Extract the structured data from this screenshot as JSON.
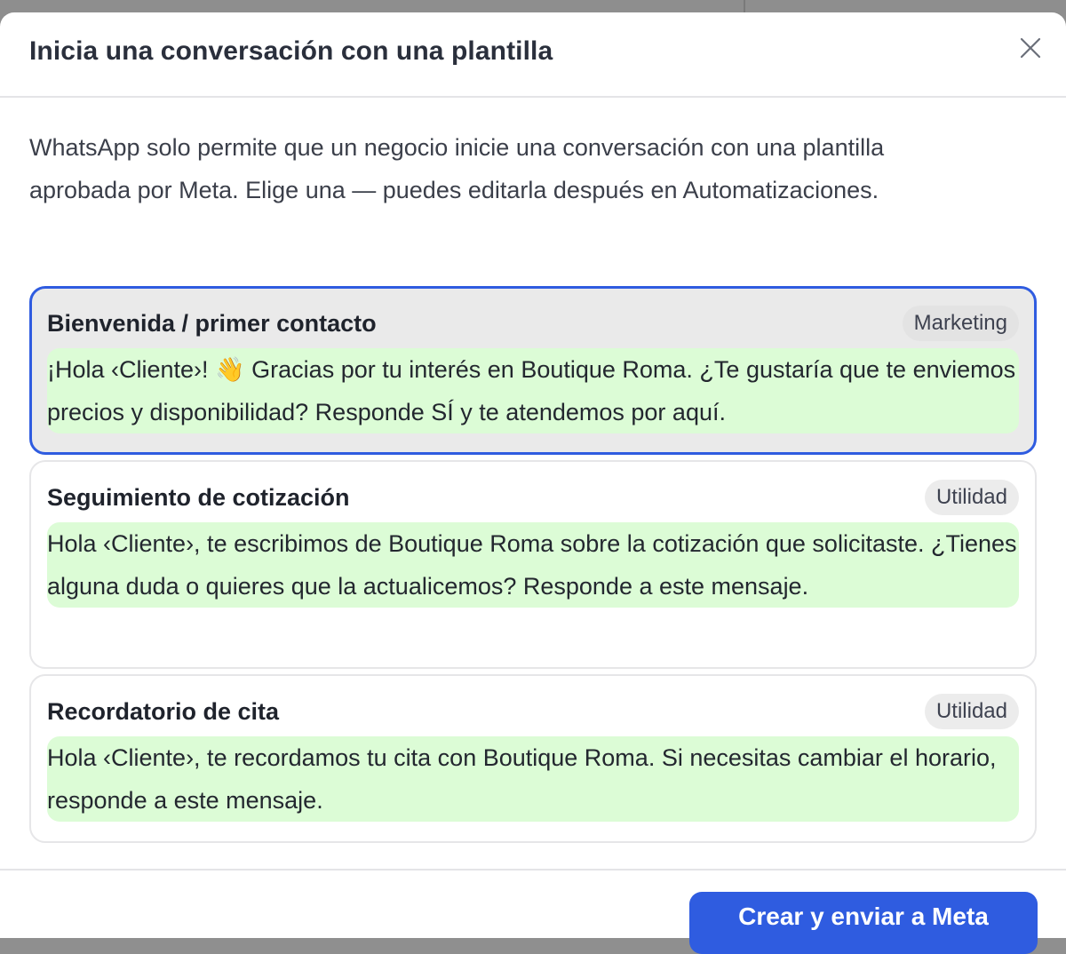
{
  "modal": {
    "title": "Inicia una conversación con una plantilla",
    "description": "WhatsApp solo permite que un negocio inicie una conversación con una plantilla aprobada por Meta. Elige una — puedes editarla después en Automatizaciones.",
    "close_icon": "close-icon"
  },
  "templates": [
    {
      "name": "Bienvenida / primer contacto",
      "category": "Marketing",
      "body": "¡Hola ‹Cliente›! 👋 Gracias por tu interés en Boutique Roma. ¿Te gustaría que te enviemos precios y disponibilidad? Responde SÍ y te atendemos por aquí.",
      "selected": true
    },
    {
      "name": "Seguimiento de cotización",
      "category": "Utilidad",
      "body": "Hola ‹Cliente›, te escribimos de Boutique Roma sobre la cotización que solicitaste. ¿Tienes alguna duda o quieres que la actualicemos? Responde a este mensaje.",
      "selected": false
    },
    {
      "name": "Recordatorio de cita",
      "category": "Utilidad",
      "body": "Hola ‹Cliente›, te recordamos tu cita con Boutique Roma. Si necesitas cambiar el horario, responde a este mensaje.",
      "selected": false
    }
  ],
  "footer": {
    "primary_label": "Crear y enviar a Meta"
  },
  "colors": {
    "accent": "#2f5ce0",
    "bubble": "#dcfcd6",
    "selected_bg": "#eaeaea"
  }
}
